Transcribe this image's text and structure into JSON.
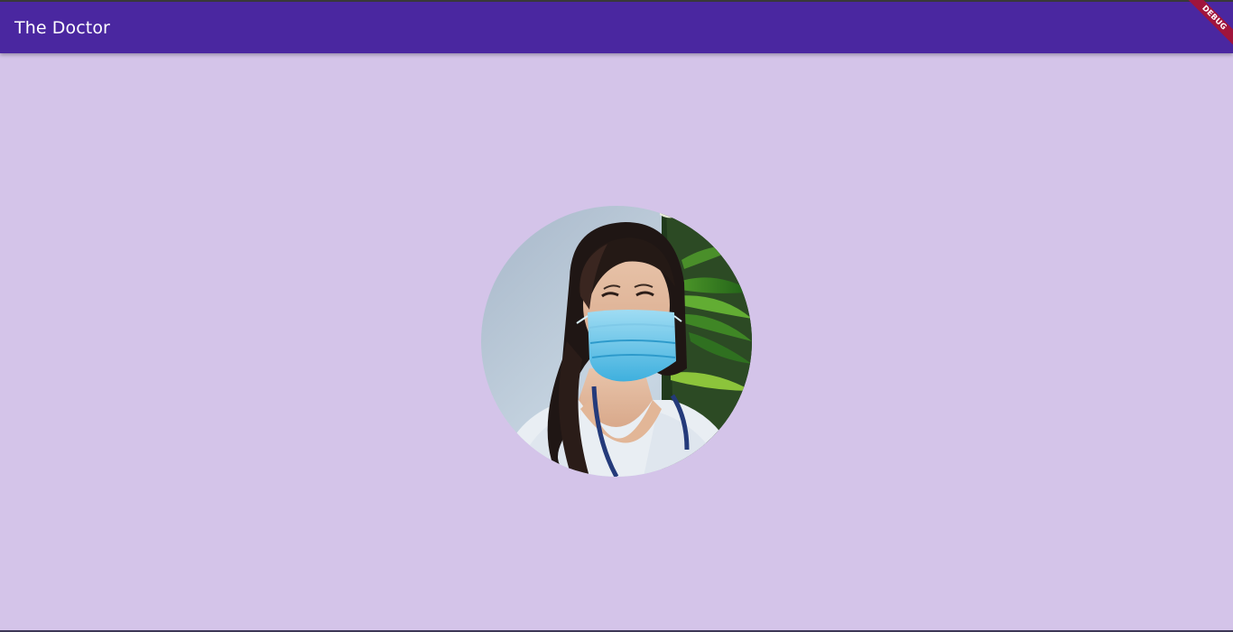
{
  "app_bar": {
    "title": "The Doctor",
    "color": "#4a27a0"
  },
  "debug_banner": {
    "label": "DEBUG",
    "color": "#a0143c"
  },
  "page": {
    "background": "#d4c4e9"
  },
  "avatar": {
    "shape": "circle",
    "subject": "doctor-with-face-mask"
  }
}
